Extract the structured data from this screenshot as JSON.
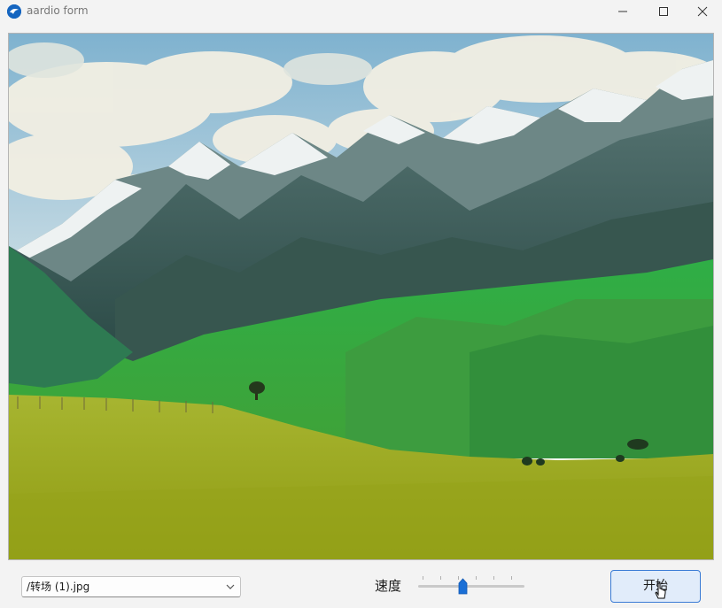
{
  "window": {
    "title": "aardio form"
  },
  "image_view": {
    "icon": "landscape-photo"
  },
  "controls": {
    "file_combo": {
      "value": "/转场 (1).jpg"
    },
    "speed_label": "速度",
    "speed_slider": {
      "value_fraction": 0.42
    },
    "start_button": "开始"
  }
}
